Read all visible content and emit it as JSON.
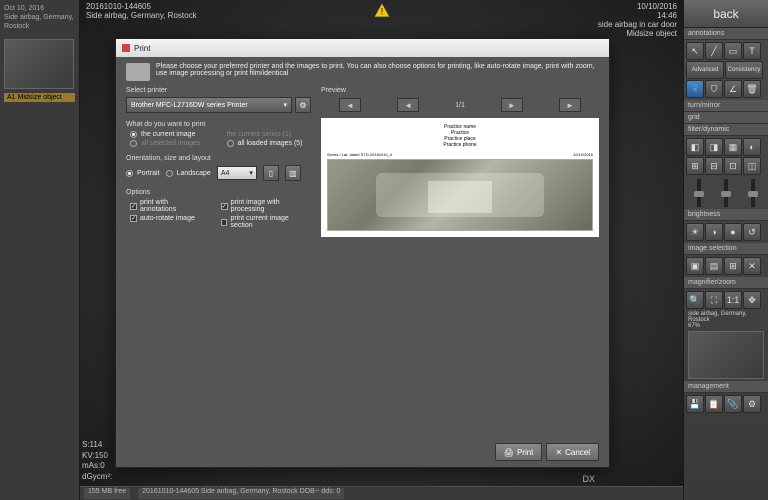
{
  "left": {
    "thumb_date": "Oct 10, 2016",
    "thumb_loc": "Side airbag, Germany, Rostock",
    "thumb_label": "A1",
    "thumb_tag": "Midsize object"
  },
  "header": {
    "left_id": "20161010-144605",
    "left_title": "Side airbag, Germany, Rostock",
    "right_date": "10/10/2016",
    "right_time": "14:46",
    "right_desc": "side airbag in car door",
    "right_tag": "Midsize object"
  },
  "bottom": {
    "s": "S:114",
    "kv": "KV:150",
    "mas": "mAs:0",
    "dg": "dGycm²:"
  },
  "status": {
    "size": "155 MB free",
    "file": "20161010-144605  Side airbag, Germany, Rostock  DOB-- dds: 0"
  },
  "dx": "DX",
  "right": {
    "back": "back",
    "sec_annot": "annotations",
    "sec_adv": "Advanced",
    "sec_consist": "Consistency",
    "sec_turn": "turn/mirror",
    "sec_grid": "grid",
    "sec_filter": "filter/dynamic",
    "sec_bright": "brightness",
    "sec_imgsel": "image selection",
    "sec_mag": "magnifier/zoom",
    "sec_mgmt": "management",
    "thumb_label": "side airbag, Germany, Rostock",
    "thumb_pct": "67%"
  },
  "dialog": {
    "title": "Print",
    "desc": "Please choose your preferred printer and the images to print. You can also choose options for printing, like auto-rotate image, print with zoom, use image processing or print film/identical",
    "sec_printer": "Select printer",
    "printer": "Brother MFC-L2716DW series Printer",
    "sec_what": "What do you want to print",
    "opt_current": "the current image",
    "opt_current_n": "the current series (1)",
    "opt_selected": "all selected images",
    "opt_loaded": "all loaded images (5)",
    "sec_orient": "Orientation, size and layout",
    "opt_portrait": "Portrait",
    "opt_landscape": "Landscape",
    "size_sel": "A4",
    "sec_options": "Options",
    "chk_annot": "print with annotations",
    "chk_proc": "print image with processing",
    "chk_autorotate": "auto-rotate image",
    "chk_section": "print current image section",
    "preview": "Preview",
    "page_ind": "1/1",
    "pg_h1": "Practice name",
    "pg_h2": "Practice",
    "pg_h3": "Practice place",
    "pg_h4": "Practice phone",
    "pg_meta_l": "Series / Lat. dated STD-20161010_0",
    "pg_meta_r": "10/10/2016",
    "btn_print": "Print",
    "btn_cancel": "Cancel"
  }
}
